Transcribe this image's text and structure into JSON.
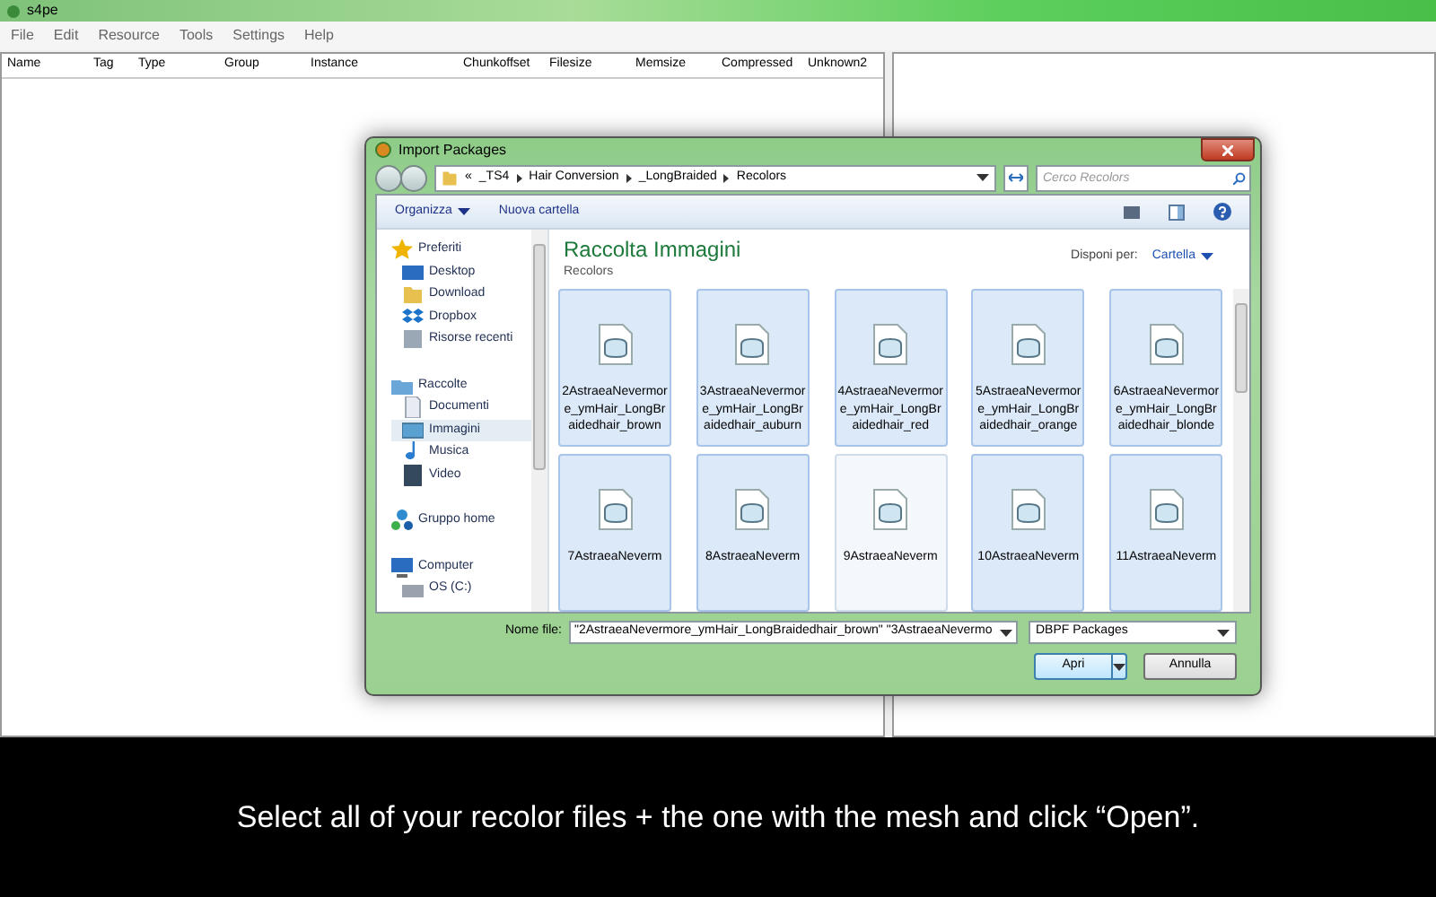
{
  "app": {
    "title": "s4pe",
    "menu": [
      "File",
      "Edit",
      "Resource",
      "Tools",
      "Settings",
      "Help"
    ],
    "columns": [
      "Name",
      "Tag",
      "Type",
      "Group",
      "Instance",
      "Chunkoffset",
      "Filesize",
      "Memsize",
      "Compressed",
      "Unknown2"
    ]
  },
  "dialog": {
    "title": "Import Packages",
    "breadcrumb": [
      "«",
      "_TS4",
      "Hair Conversion",
      "_LongBraided",
      "Recolors"
    ],
    "search": {
      "placeholder": "Cerco Recolors"
    },
    "toolbar": [
      "Organizza",
      "Nuova cartella"
    ],
    "sidebar": [
      {
        "kind": "group",
        "label": "Preferiti",
        "selected": false
      },
      {
        "kind": "item",
        "label": "Desktop",
        "selected": false
      },
      {
        "kind": "item",
        "label": "Download",
        "selected": false
      },
      {
        "kind": "item",
        "label": "Dropbox",
        "selected": false
      },
      {
        "kind": "item",
        "label": "Risorse recenti",
        "selected": false
      },
      {
        "kind": "group",
        "label": "Raccolte",
        "selected": false
      },
      {
        "kind": "item",
        "label": "Documenti",
        "selected": false
      },
      {
        "kind": "item",
        "label": "Immagini",
        "selected": true
      },
      {
        "kind": "item",
        "label": "Musica",
        "selected": false
      },
      {
        "kind": "item",
        "label": "Video",
        "selected": false
      },
      {
        "kind": "group",
        "label": "Gruppo home",
        "selected": false
      },
      {
        "kind": "group",
        "label": "Computer",
        "selected": false
      },
      {
        "kind": "item",
        "label": "OS (C:)",
        "selected": false
      }
    ],
    "library_title": "Raccolta Immagini",
    "library_subtitle": "Recolors",
    "arrange_label": "Disponi per:",
    "arrange_value": "Cartella",
    "files": [
      {
        "name": "2AstraeaNevermore_ymHair_LongBraidedhair_brown",
        "selected": true
      },
      {
        "name": "3AstraeaNevermore_ymHair_LongBraidedhair_auburn",
        "selected": true
      },
      {
        "name": "4AstraeaNevermore_ymHair_LongBraidedhair_red",
        "selected": true
      },
      {
        "name": "5AstraeaNevermore_ymHair_LongBraidedhair_orange",
        "selected": true
      },
      {
        "name": "6AstraeaNevermore_ymHair_LongBraidedhair_blonde",
        "selected": true
      },
      {
        "name": "7AstraeaNeverm",
        "selected": true
      },
      {
        "name": "8AstraeaNeverm",
        "selected": true
      },
      {
        "name": "9AstraeaNeverm",
        "selected": false
      },
      {
        "name": "10AstraeaNeverm",
        "selected": true
      },
      {
        "name": "11AstraeaNeverm",
        "selected": true
      }
    ],
    "filename_label": "Nome file:",
    "filename_value": "\"2AstraeaNevermore_ymHair_LongBraidedhair_brown\" \"3AstraeaNevermo",
    "filetype": "DBPF Packages",
    "open_button": "Apri",
    "cancel_button": "Annulla"
  },
  "caption": "Select all of your recolor files + the one with the mesh and click “Open”."
}
